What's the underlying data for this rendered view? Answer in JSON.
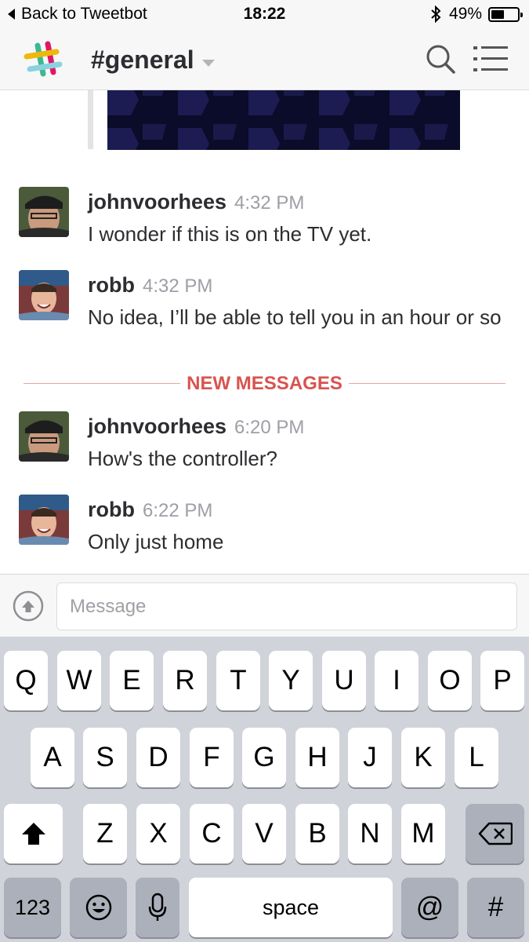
{
  "status_bar": {
    "back_label": "Back to Tweetbot",
    "time": "18:22",
    "bluetooth_icon": "bluetooth-icon",
    "battery_text": "49%",
    "battery_level": 0.49
  },
  "header": {
    "channel": "#general",
    "logo_icon": "slack-logo-icon",
    "search_icon": "search-icon",
    "menu_icon": "list-menu-icon"
  },
  "messages": [
    {
      "author": "johnvoorhees",
      "time": "4:32 PM",
      "text": "I wonder if this is on the TV yet."
    },
    {
      "author": "robb",
      "time": "4:32 PM",
      "text": "No idea, I’ll be able to tell you in an hour or so"
    },
    {
      "author": "johnvoorhees",
      "time": "6:20 PM",
      "text": "How's the controller?"
    },
    {
      "author": "robb",
      "time": "6:22 PM",
      "text": "Only just home"
    }
  ],
  "divider": {
    "label": "NEW MESSAGES",
    "color": "#d9534f"
  },
  "composer": {
    "placeholder": "Message",
    "upload_icon": "upload-arrow-icon"
  },
  "keyboard": {
    "row1": [
      "Q",
      "W",
      "E",
      "R",
      "T",
      "Y",
      "U",
      "I",
      "O",
      "P"
    ],
    "row2": [
      "A",
      "S",
      "D",
      "F",
      "G",
      "H",
      "J",
      "K",
      "L"
    ],
    "row3": [
      "Z",
      "X",
      "C",
      "V",
      "B",
      "N",
      "M"
    ],
    "shift_icon": "shift-arrow-icon",
    "delete_icon": "backspace-icon",
    "numbers_label": "123",
    "emoji_icon": "emoji-icon",
    "mic_icon": "microphone-icon",
    "space_label": "space",
    "at_label": "@",
    "hash_label": "#"
  }
}
